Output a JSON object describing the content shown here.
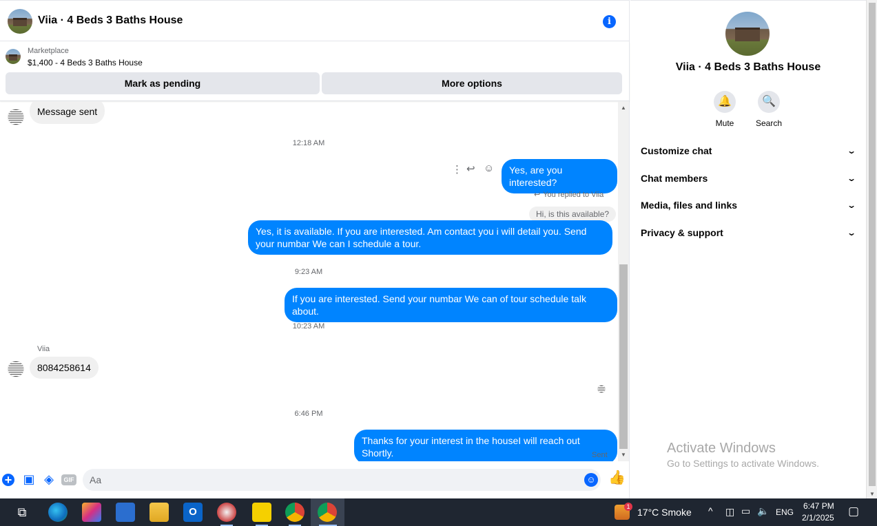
{
  "header": {
    "title": "Viia · 4 Beds 3 Baths House"
  },
  "marketplace": {
    "label": "Marketplace",
    "listing": "$1,400 - 4 Beds 3 Baths House",
    "pending_button": "Mark as pending",
    "more_button": "More options"
  },
  "messages": {
    "m1": "Message sent",
    "t1": "12:18 AM",
    "m2": "Yes, are you interested?",
    "reply_note": "You replied to Viia",
    "quoted": "Hi, is this available?",
    "m3": "Yes, it is available. If you are interested. Am contact you i will detail you. Send your numbar We can I schedule a tour.",
    "t2": "9:23 AM",
    "m4": "If you are interested. Send your numbar We can of tour  schedule talk about.",
    "t3": "10:23 AM",
    "sender": "Viia",
    "m5": "8084258614",
    "t4": "6:46 PM",
    "m6": "Thanks for your interest in the houseI will reach out Shortly.",
    "status": "Sent"
  },
  "composer": {
    "placeholder": "Aa",
    "gif_label": "GIF"
  },
  "panel": {
    "title": "Viia · 4 Beds 3 Baths House",
    "mute_label": "Mute",
    "search_label": "Search",
    "sections": [
      "Customize chat",
      "Chat members",
      "Media, files and links",
      "Privacy & support"
    ]
  },
  "watermark": {
    "title": "Activate Windows",
    "subtitle": "Go to Settings to activate Windows."
  },
  "taskbar": {
    "weather": "17°C  Smoke",
    "notification_count": "1",
    "language": "ENG",
    "time": "6:47 PM",
    "date": "2/1/2025"
  },
  "colors": {
    "accent": "#0866ff",
    "outgoing_bubble": "#0084ff",
    "taskbar": "#1f2631"
  }
}
